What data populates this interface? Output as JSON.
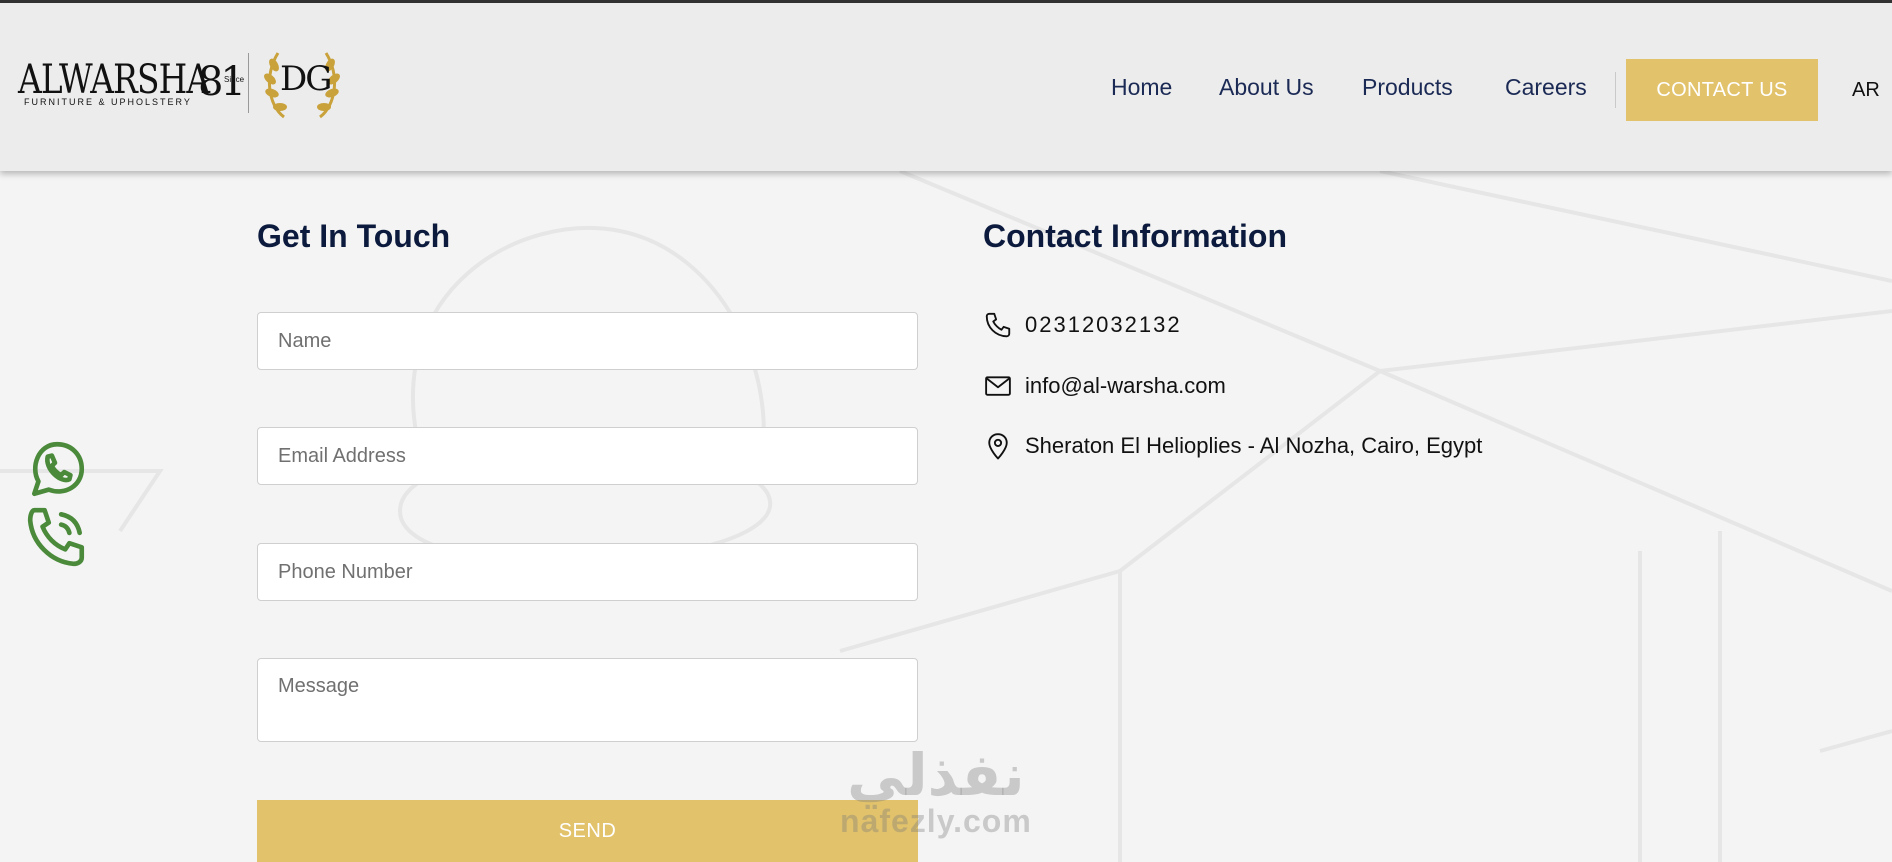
{
  "header": {
    "logo": {
      "brand": "ALWARSHA",
      "tagline": "FURNITURE & UPHOLSTERY",
      "since_number": "81",
      "since_label": "Since",
      "emblem": "DG"
    },
    "nav": [
      {
        "label": "Home"
      },
      {
        "label": "About Us"
      },
      {
        "label": "Products"
      },
      {
        "label": "Careers"
      }
    ],
    "contact_button": "CONTACT US",
    "language_toggle": "AR"
  },
  "form": {
    "title": "Get In Touch",
    "name_placeholder": "Name",
    "email_placeholder": "Email Address",
    "phone_placeholder": "Phone Number",
    "message_placeholder": "Message",
    "send_label": "SEND"
  },
  "contact_info": {
    "title": "Contact Information",
    "phone": "02312032132",
    "email": "info@al-warsha.com",
    "address": "Sheraton El Helioplies - Al Nozha, Cairo, Egypt"
  },
  "floating": {
    "icons": [
      "whatsapp-icon",
      "phone-call-icon"
    ],
    "accent": "#4a8a3a"
  },
  "watermark": {
    "arabic": "نفذلي",
    "latin": "nafezly.com"
  },
  "colors": {
    "accent": "#e2c36c",
    "heading": "#0b1a3d",
    "nav_text": "#1b2a55"
  }
}
